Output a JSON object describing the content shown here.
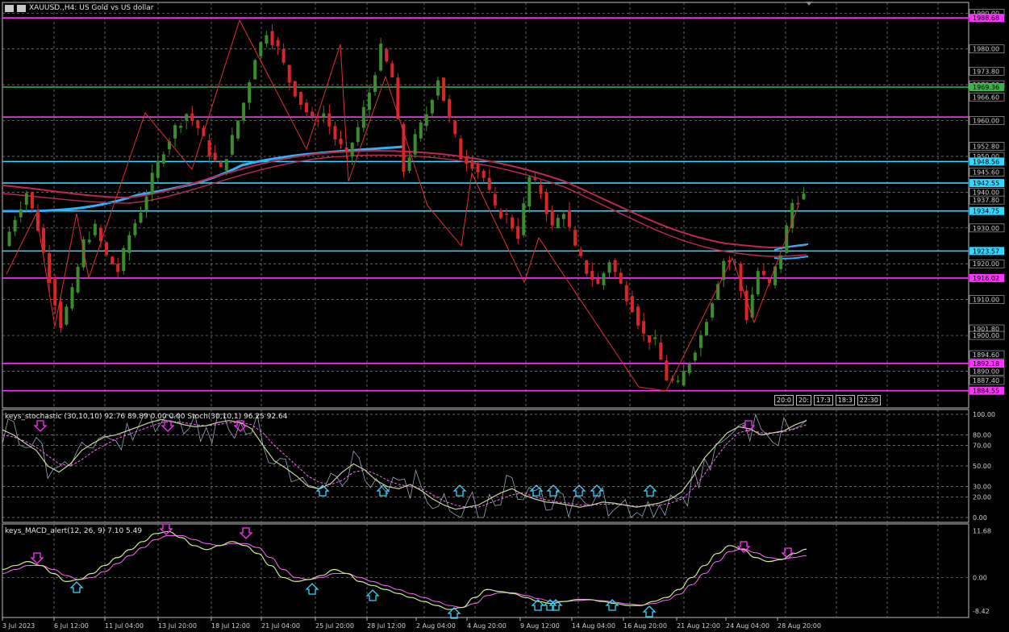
{
  "header": {
    "symbol": "XAUUSD.,H4: US Gold vs US dollar"
  },
  "colors": {
    "background": "#000000",
    "grid": "#8a8a8a",
    "bull": "#3b8c2e",
    "bear": "#d9252a",
    "magenta": "#ff33ff",
    "cyan": "#33d6ff",
    "green_level": "#39b54a",
    "ma_blue": "#2ab3ff",
    "ma_red": "#c0284e",
    "stoch_main": "#c8d6a0",
    "stoch_signal": "#ff66ff",
    "macd_main": "#c9f08a",
    "macd_signal": "#ff66ff",
    "stoch_raw": "#9aa6b8"
  },
  "price_axis": {
    "labels": [
      {
        "value": "1990.00",
        "type": "plain"
      },
      {
        "value": "1988.68",
        "type": "magenta"
      },
      {
        "value": "1980.00",
        "type": "plain"
      },
      {
        "value": "1973.80",
        "type": "plain"
      },
      {
        "value": "1970.00",
        "type": "plain"
      },
      {
        "value": "1969.36",
        "type": "green"
      },
      {
        "value": "1966.60",
        "type": "plain"
      },
      {
        "value": "1960.00",
        "type": "plain"
      },
      {
        "value": "1952.80",
        "type": "plain"
      },
      {
        "value": "1950.00",
        "type": "plain"
      },
      {
        "value": "1948.56",
        "type": "cyan"
      },
      {
        "value": "1945.60",
        "type": "plain"
      },
      {
        "value": "1942.55",
        "type": "cyan"
      },
      {
        "value": "1940.00",
        "type": "plain"
      },
      {
        "value": "1937.80",
        "type": "plain"
      },
      {
        "value": "1934.75",
        "type": "cyan"
      },
      {
        "value": "1930.00",
        "type": "plain"
      },
      {
        "value": "1923.57",
        "type": "cyan"
      },
      {
        "value": "1920.00",
        "type": "plain"
      },
      {
        "value": "1916.02",
        "type": "magenta"
      },
      {
        "value": "1910.00",
        "type": "plain"
      },
      {
        "value": "1901.80",
        "type": "plain"
      },
      {
        "value": "1900.00",
        "type": "plain"
      },
      {
        "value": "1894.60",
        "type": "plain"
      },
      {
        "value": "1892.18",
        "type": "magenta"
      },
      {
        "value": "1890.00",
        "type": "plain"
      },
      {
        "value": "1887.40",
        "type": "plain"
      },
      {
        "value": "1884.55",
        "type": "magenta"
      }
    ]
  },
  "levels": [
    {
      "price": 1988.68,
      "color": "magenta"
    },
    {
      "price": 1969.36,
      "color": "green"
    },
    {
      "price": 1960.98,
      "color": "magenta"
    },
    {
      "price": 1948.56,
      "color": "cyan"
    },
    {
      "price": 1942.55,
      "color": "cyan"
    },
    {
      "price": 1934.75,
      "color": "cyan"
    },
    {
      "price": 1923.57,
      "color": "cyan"
    },
    {
      "price": 1916.02,
      "color": "magenta"
    },
    {
      "price": 1892.18,
      "color": "magenta"
    },
    {
      "price": 1884.55,
      "color": "magenta"
    }
  ],
  "price_range": [
    1882.0,
    1993.0
  ],
  "price_path": [
    1925,
    1933,
    1940,
    1930,
    1916,
    1903,
    1912,
    1926,
    1930,
    1922,
    1918,
    1928,
    1935,
    1944,
    1952,
    1958,
    1962,
    1958,
    1951,
    1946,
    1955,
    1965,
    1978,
    1985,
    1980,
    1971,
    1965,
    1960,
    1962,
    1955,
    1950,
    1958,
    1968,
    1980,
    1972,
    1946,
    1955,
    1962,
    1972,
    1960,
    1950,
    1948,
    1944,
    1935,
    1933,
    1928,
    1944,
    1940,
    1930,
    1935,
    1924,
    1918,
    1914,
    1921,
    1914,
    1908,
    1900,
    1898,
    1888,
    1886,
    1893,
    1900,
    1910,
    1921,
    1920,
    1905,
    1918,
    1914,
    1923,
    1937,
    1939
  ],
  "stochastic": {
    "title": "keys_stochastic (30,10,10) 92.76 89.89 0.00 0.00 Stoch(30,10,1) 96.25 92.64",
    "axis": [
      "100.00",
      "80.00",
      "70.00",
      "50.00",
      "30.00",
      "20.00",
      "0.00"
    ],
    "axis_values": [
      100,
      80,
      70,
      50,
      30,
      20,
      0
    ],
    "main": [
      85,
      80,
      72,
      65,
      50,
      44,
      52,
      65,
      72,
      78,
      80,
      84,
      88,
      92,
      95,
      93,
      90,
      88,
      89,
      92,
      94,
      92,
      86,
      70,
      55,
      48,
      40,
      30,
      28,
      33,
      44,
      52,
      46,
      36,
      30,
      28,
      32,
      26,
      18,
      12,
      8,
      10,
      12,
      18,
      24,
      28,
      22,
      18,
      15,
      14,
      12,
      10,
      12,
      15,
      14,
      12,
      10,
      12,
      14,
      18,
      25,
      40,
      58,
      70,
      82,
      88,
      86,
      80,
      82,
      84,
      90,
      94
    ],
    "signal": [
      80,
      78,
      74,
      68,
      60,
      52,
      50,
      56,
      64,
      70,
      76,
      80,
      84,
      88,
      92,
      93,
      92,
      90,
      89,
      90,
      92,
      92,
      90,
      82,
      70,
      60,
      50,
      40,
      34,
      32,
      36,
      44,
      46,
      42,
      36,
      32,
      30,
      28,
      22,
      16,
      12,
      10,
      10,
      14,
      18,
      22,
      24,
      20,
      17,
      15,
      14,
      12,
      12,
      13,
      13,
      12,
      11,
      11,
      12,
      14,
      18,
      28,
      42,
      58,
      72,
      82,
      85,
      82,
      82,
      83,
      86,
      90
    ]
  },
  "macd": {
    "title": "keys_MACD_alert(12, 26, 9) 7.10 5.49",
    "axis": [
      "11.68",
      "0.00",
      "-8.42"
    ],
    "axis_values": [
      11.68,
      0,
      -8.42
    ],
    "range": [
      -9.2,
      12.6
    ],
    "main": [
      2,
      3,
      4,
      3,
      1,
      -1,
      -0.5,
      1,
      3,
      5,
      7,
      9,
      11,
      11.5,
      10,
      8,
      7,
      8,
      9,
      8,
      6,
      3,
      0,
      -1,
      -0.5,
      0.5,
      2,
      1,
      -1,
      -2,
      -3,
      -4,
      -5,
      -6,
      -7,
      -8,
      -7.5,
      -5,
      -3,
      -3.5,
      -4,
      -5,
      -6,
      -6.5,
      -6,
      -5.5,
      -5.5,
      -6,
      -6.5,
      -7,
      -7,
      -6,
      -5,
      -3,
      0,
      3,
      6,
      8,
      7,
      5,
      4,
      4.5,
      6,
      7.1
    ],
    "signal": [
      1,
      2,
      3,
      3,
      2,
      0.5,
      -0.5,
      0,
      1.5,
      3.5,
      5.5,
      7.5,
      9.5,
      10.5,
      10.5,
      9.5,
      8.5,
      8,
      8.5,
      8.5,
      7.5,
      5,
      2,
      0,
      -0.5,
      0,
      1,
      1,
      0,
      -1,
      -2,
      -3,
      -4,
      -5,
      -6,
      -7,
      -7.5,
      -6.5,
      -4.5,
      -3.8,
      -3.8,
      -4.5,
      -5.3,
      -6,
      -6,
      -5.8,
      -5.6,
      -5.8,
      -6.2,
      -6.6,
      -6.9,
      -6.5,
      -5.7,
      -4.2,
      -1.8,
      1,
      4,
      6.5,
      7.2,
      6.2,
      5,
      4.6,
      5,
      5.49
    ]
  },
  "time_axis": [
    "3 Jul 2023",
    "6 Jul 12:00",
    "11 Jul 04:00",
    "13 Jul 20:00",
    "18 Jul 12:00",
    "21 Jul 04:00",
    "25 Jul 20:00",
    "28 Jul 12:00",
    "2 Aug 04:00",
    "4 Aug 20:00",
    "9 Aug 12:00",
    "14 Aug 04:00",
    "16 Aug 20:00",
    "21 Aug 12:00",
    "24 Aug 04:00",
    "28 Aug 20:00"
  ],
  "time_boxes": [
    "20:0",
    "20:",
    "17:3",
    "18:3",
    "22:30"
  ]
}
